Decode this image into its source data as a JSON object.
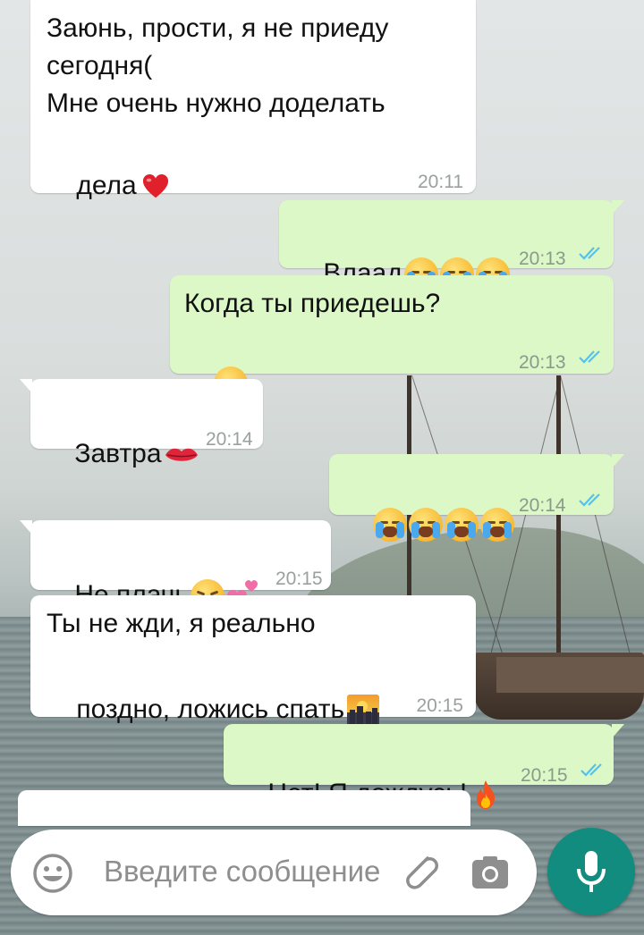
{
  "colors": {
    "incoming_bubble": "#ffffff",
    "outgoing_bubble": "#dcf8c6",
    "read_ticks": "#4fc3f7",
    "mic_button": "#128c7e"
  },
  "messages": [
    {
      "direction": "in",
      "lines": [
        "Заюнь, прости, я не приеду",
        "сегодня(",
        "Мне очень нужно доделать",
        "дела"
      ],
      "emojis": [
        "red-heart"
      ],
      "time": "20:11"
    },
    {
      "direction": "out",
      "text": "Влаад",
      "emojis": [
        "loudly-crying-face",
        "loudly-crying-face",
        "loudly-crying-face"
      ],
      "time": "20:13",
      "status": "read"
    },
    {
      "direction": "out",
      "text": "Когда ты приедешь?",
      "emojis": [
        "pensive-face"
      ],
      "time": "20:13",
      "status": "read"
    },
    {
      "direction": "in",
      "text": "Завтра",
      "emojis": [
        "kiss-mark"
      ],
      "time": "20:14"
    },
    {
      "direction": "out",
      "text": "",
      "emojis": [
        "loudly-crying-face",
        "loudly-crying-face",
        "loudly-crying-face",
        "loudly-crying-face"
      ],
      "time": "20:14",
      "status": "read"
    },
    {
      "direction": "in",
      "text": "Не плачь",
      "emojis": [
        "kissing-face-closed-eyes",
        "two-hearts"
      ],
      "time": "20:15"
    },
    {
      "direction": "in",
      "lines": [
        "Ты не жди, я реально",
        "поздно, ложись спать"
      ],
      "emojis": [
        "city-sunset"
      ],
      "time": "20:15"
    },
    {
      "direction": "out",
      "text": "Нет! Я дождусь!",
      "emojis": [
        "fire"
      ],
      "time": "20:15",
      "status": "read"
    }
  ],
  "input": {
    "placeholder": "Введите сообщение",
    "icons": [
      "emoji-icon",
      "attach-icon",
      "camera-icon"
    ]
  },
  "mic_button": {
    "icon": "microphone-icon"
  }
}
